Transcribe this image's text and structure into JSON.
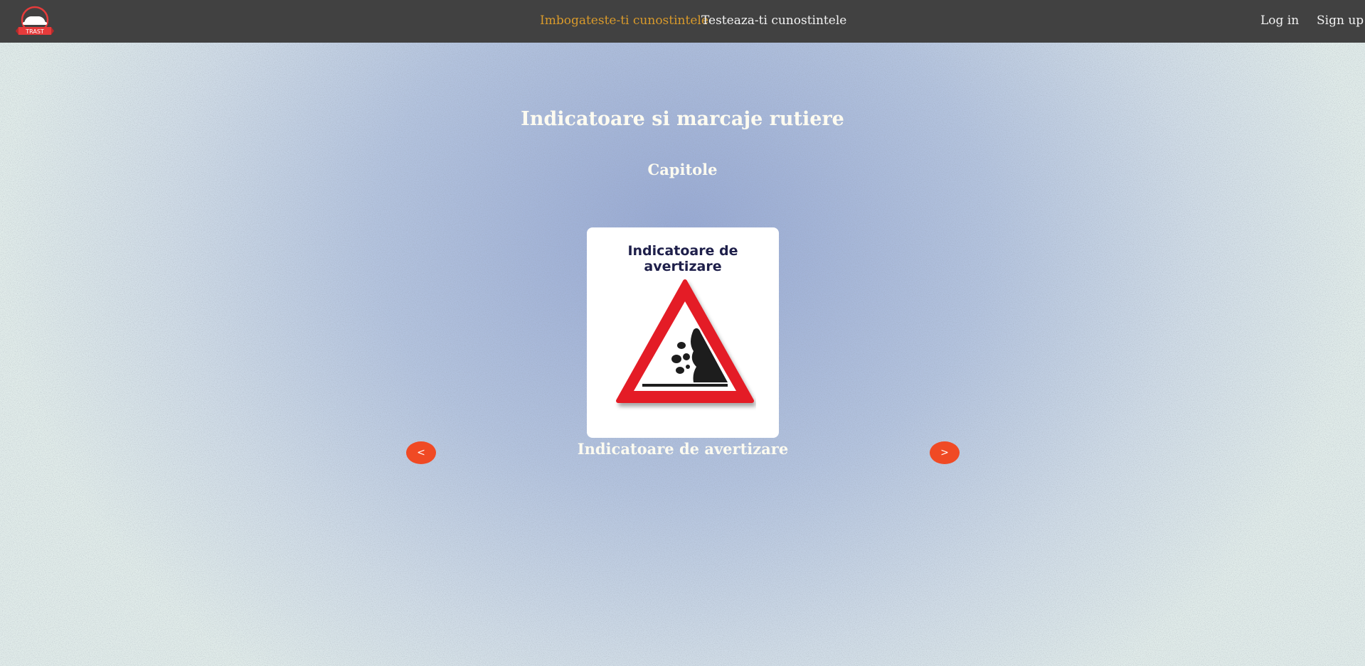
{
  "nav": {
    "logo_text": "TRAST",
    "links": [
      {
        "label": "Imbogateste-ti cunostintele",
        "active": true
      },
      {
        "label": "Testeaza-ti cunostintele",
        "active": false
      }
    ],
    "login_label": "Log in",
    "signup_label": "Sign up"
  },
  "main": {
    "title": "Indicatoare si marcaje rutiere",
    "subtitle": "Capitole"
  },
  "carousel": {
    "card_heading": "Indicatoare de avertizare",
    "card_icon": "falling-rocks-warning-sign",
    "caption": "Indicatoare de avertizare",
    "prev_label": "<",
    "next_label": ">"
  },
  "colors": {
    "navbar": "#414141",
    "active_link": "#d99a2b",
    "arrow_button": "#f04a24",
    "sign_border": "#e41e26"
  }
}
